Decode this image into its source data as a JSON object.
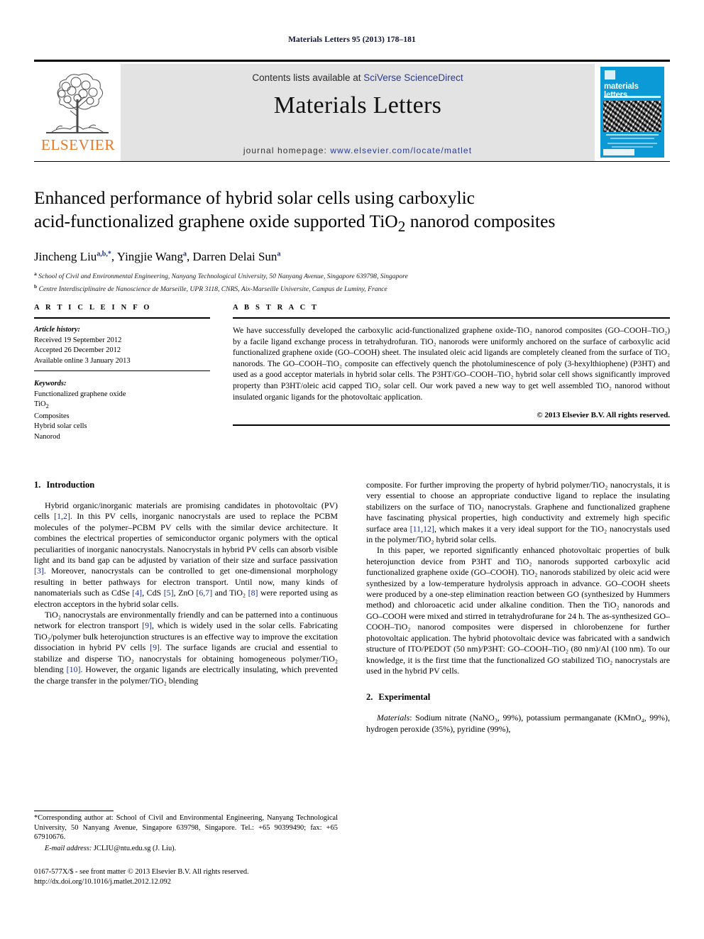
{
  "running_head": "Materials Letters 95 (2013) 178–181",
  "masthead": {
    "contents_prefix": "Contents lists available at ",
    "contents_link": "SciVerse ScienceDirect",
    "journal_title": "Materials Letters",
    "homepage_prefix": "journal homepage: ",
    "homepage_url": "www.elsevier.com/locate/matlet",
    "publisher_name": "ELSEVIER",
    "cover_title": "materials letters",
    "accent_color": "#0c9ad6",
    "link_color": "#2b3a8f",
    "publisher_color": "#E87722"
  },
  "article": {
    "title_line1": "Enhanced performance of hybrid solar cells using carboxylic",
    "title_line2_a": "acid-functionalized graphene oxide supported TiO",
    "title_line2_sub": "2",
    "title_line2_b": " nanorod composites",
    "authors": [
      {
        "name": "Jincheng Liu",
        "sup": "a,b,*"
      },
      {
        "name": "Yingjie Wang",
        "sup": "a"
      },
      {
        "name": "Darren Delai Sun",
        "sup": "a"
      }
    ],
    "affiliations": [
      {
        "mark": "a",
        "text": "School of Civil and Environmental Engineering, Nanyang Technological University, 50 Nanyang Avenue, Singapore 639798, Singapore"
      },
      {
        "mark": "b",
        "text": "Centre Interdisciplinaire de Nanoscience de Marseille, UPR 3118, CNRS, Aix-Marseille Universite, Campus de Luminy, France"
      }
    ]
  },
  "article_info": {
    "heading": "A R T I C L E   I N F O",
    "history_label": "Article history:",
    "history": [
      "Received 19 September 2012",
      "Accepted 26 December 2012",
      "Available online 3 January 2013"
    ],
    "keywords_label": "Keywords:",
    "keywords_1": "Functionalized graphene oxide",
    "keywords_2_a": "TiO",
    "keywords_2_sub": "2",
    "keywords_3": "Composites",
    "keywords_4": "Hybrid solar cells",
    "keywords_5": "Nanorod"
  },
  "abstract": {
    "heading": "A B S T R A C T",
    "text": "We have successfully developed the carboxylic acid-functionalized graphene oxide-TiO₂ nanorod composites (GO–COOH–TiO₂) by a facile ligand exchange process in tetrahydrofuran. TiO₂ nanorods were uniformly anchored on the surface of carboxylic acid functionalized graphene oxide (GO–COOH) sheet. The insulated oleic acid ligands are completely cleaned from the surface of TiO₂ nanorods. The GO–COOH–TiO₂ composite can effectively quench the photoluminescence of poly (3-hexylthiophene) (P3HT) and used as a good acceptor materials in hybrid solar cells. The P3HT/GO–COOH–TiO₂ hybrid solar cell shows significantly improved property than P3HT/oleic acid capped TiO₂ solar cell. Our work paved a new way to get well assembled TiO₂ nanorod without insulated organic ligands for the photovoltaic application.",
    "copyright": "© 2013 Elsevier B.V. All rights reserved."
  },
  "sections": {
    "intro_num": "1.",
    "intro_title": "Introduction",
    "experimental_num": "2.",
    "experimental_title": "Experimental"
  },
  "body": {
    "left_p1_a": "Hybrid organic/inorganic materials are promising candidates in photovoltaic (PV) cells ",
    "left_p1_r1": "[1,2]",
    "left_p1_b": ". In this PV cells, inorganic nanocrystals are used to replace the PCBM molecules of the polymer–PCBM PV cells with the similar device architecture. It combines the electrical properties of semiconductor organic polymers with the optical peculiarities of inorganic nanocrystals. Nanocrystals in hybrid PV cells can absorb visible light and its band gap can be adjusted by variation of their size and surface passivation ",
    "left_p1_r2": "[3]",
    "left_p1_c": ". Moreover, nanocrystals can be controlled to get one-dimensional morphology resulting in better pathways for electron transport. Until now, many kinds of nanomaterials such as CdSe ",
    "left_p1_r3": "[4]",
    "left_p1_d": ", CdS ",
    "left_p1_r4": "[5]",
    "left_p1_e": ", ZnO ",
    "left_p1_r5": "[6,7]",
    "left_p1_f": " and TiO₂ ",
    "left_p1_r6": "[8]",
    "left_p1_g": " were reported using as electron acceptors in the hybrid solar cells.",
    "left_p2_a": "TiO₂ nanocrystals are environmentally friendly and can be patterned into a continuous network for electron transport ",
    "left_p2_r1": "[9]",
    "left_p2_b": ", which is widely used in the solar cells. Fabricating TiO₂/polymer bulk heterojunction structures is an effective way to improve the excitation dissociation in hybrid PV cells ",
    "left_p2_r2": "[9]",
    "left_p2_c": ". The surface ligands are crucial and essential to stabilize and disperse TiO₂ nanocrystals for obtaining homogeneous polymer/TiO₂ blending ",
    "left_p2_r3": "[10]",
    "left_p2_d": ". However, the organic ligands are electrically insulating, which prevented the charge transfer in the polymer/TiO₂ blending",
    "right_p1_a": "composite. For further improving the property of hybrid polymer/TiO₂ nanocrystals, it is very essential to choose an appropriate conductive ligand to replace the insulating stabilizers on the surface of TiO₂ nanocrystals. Graphene and functionalized graphene have fascinating physical properties, high conductivity and extremely high specific surface area ",
    "right_p1_r1": "[11,12]",
    "right_p1_b": ", which makes it a very ideal support for the TiO₂ nanocrystals used in the polymer/TiO₂ hybrid solar cells.",
    "right_p2": "In this paper, we reported significantly enhanced photovoltaic properties of bulk heterojunction device from P3HT and TiO₂ nanorods supported carboxylic acid functionalized graphene oxide (GO–COOH). TiO₂ nanorods stabilized by oleic acid were synthesized by a low-temperature hydrolysis approach in advance. GO–COOH sheets were produced by a one-step elimination reaction between GO (synthesized by Hummers method) and chloroacetic acid under alkaline condition. Then the TiO₂ nanorods and GO–COOH were mixed and stirred in tetrahydrofurane for 24 h. The as-synthesized GO–COOH–TiO₂ nanorod composites were dispersed in chlorobenzene for further photovoltaic application. The hybrid photovoltaic device was fabricated with a sandwich structure of ITO/PEDOT (50 nm)/P3HT: GO–COOH–TiO₂ (80 nm)/Al (100 nm). To our knowledge, it is the first time that the functionalized GO stabilized TiO₂ nanocrystals are used in the hybrid PV cells.",
    "right_p3_label": "Materials",
    "right_p3": ": Sodium nitrate (NaNO₃, 99%), potassium permanganate (KMnO₄, 99%), hydrogen peroxide (35%), pyridine (99%),"
  },
  "footnote": {
    "corresponding": "*Corresponding author at: School of Civil and Environmental Engineering, Nanyang Technological University, 50 Nanyang Avenue, Singapore 639798, Singapore. Tel.: +65 90399490; fax: +65 67910676.",
    "email_label": "E-mail address:",
    "email_value": " JCLIU@ntu.edu.sg (J. Liu)."
  },
  "footer": {
    "line1": "0167-577X/$ - see front matter © 2013 Elsevier B.V. All rights reserved.",
    "line2": "http://dx.doi.org/10.1016/j.matlet.2012.12.092"
  }
}
